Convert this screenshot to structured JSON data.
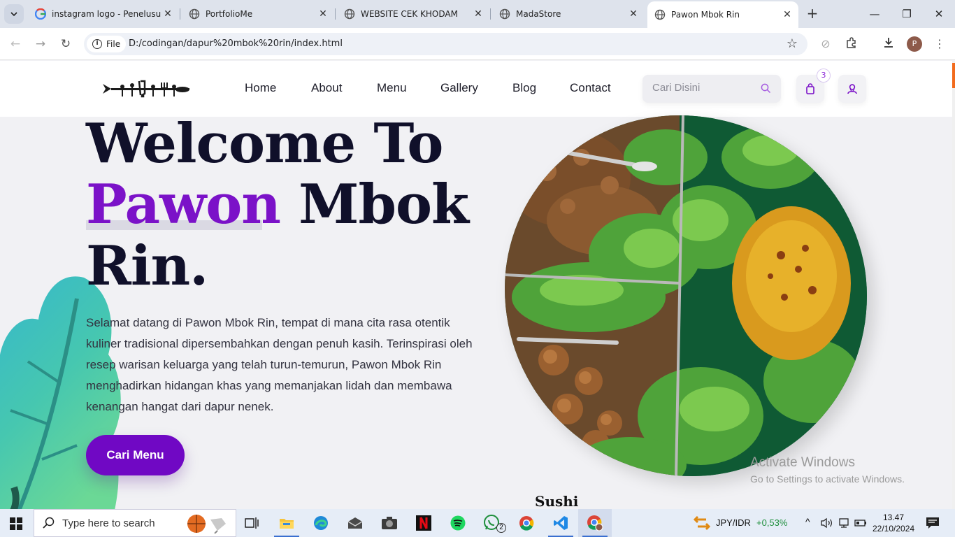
{
  "browser": {
    "tabs": [
      {
        "title": "instagram logo - Penelusura",
        "favicon": "google-g-icon"
      },
      {
        "title": "PortfolioMe",
        "favicon": "globe-icon"
      },
      {
        "title": "WEBSITE CEK KHODAM",
        "favicon": "globe-icon"
      },
      {
        "title": "MadaStore",
        "favicon": "globe-icon"
      },
      {
        "title": "Pawon Mbok Rin",
        "favicon": "globe-icon",
        "active": true
      }
    ],
    "new_tab": "+",
    "address": {
      "chip": "File",
      "url": "D:/codingan/dapur%20mbok%20rin/index.html"
    },
    "profile_initial": "P"
  },
  "site": {
    "nav": [
      "Home",
      "About",
      "Menu",
      "Gallery",
      "Blog",
      "Contact"
    ],
    "search_placeholder": "Cari Disini",
    "cart_count": "3",
    "hero": {
      "line1": "Welcome To",
      "line2_accent": "Pawon",
      "line2_rest": "Mbok",
      "line3": "Rin.",
      "description": "Selamat datang di Pawon Mbok Rin, tempat di mana cita rasa otentik kuliner tradisional dipersembahkan dengan penuh kasih. Terinspirasi oleh resep warisan keluarga yang telah turun-temurun, Pawon Mbok Rin menghadirkan hidangan khas yang memanjakan lidah dan membawa kenangan hangat dari dapur nenek.",
      "cta": "Cari Menu"
    },
    "next_section_title": "Sushi",
    "colors": {
      "accent": "#7b12c8",
      "button": "#7008c4",
      "title": "#10102a"
    }
  },
  "watermark": {
    "line1": "Activate Windows",
    "line2": "Go to Settings to activate Windows."
  },
  "taskbar": {
    "search_placeholder": "Type here to search",
    "whatsapp_badge": "2",
    "ticker": {
      "pair": "JPY/IDR",
      "change": "+0,53%"
    },
    "time": "13.47",
    "date": "22/10/2024"
  }
}
